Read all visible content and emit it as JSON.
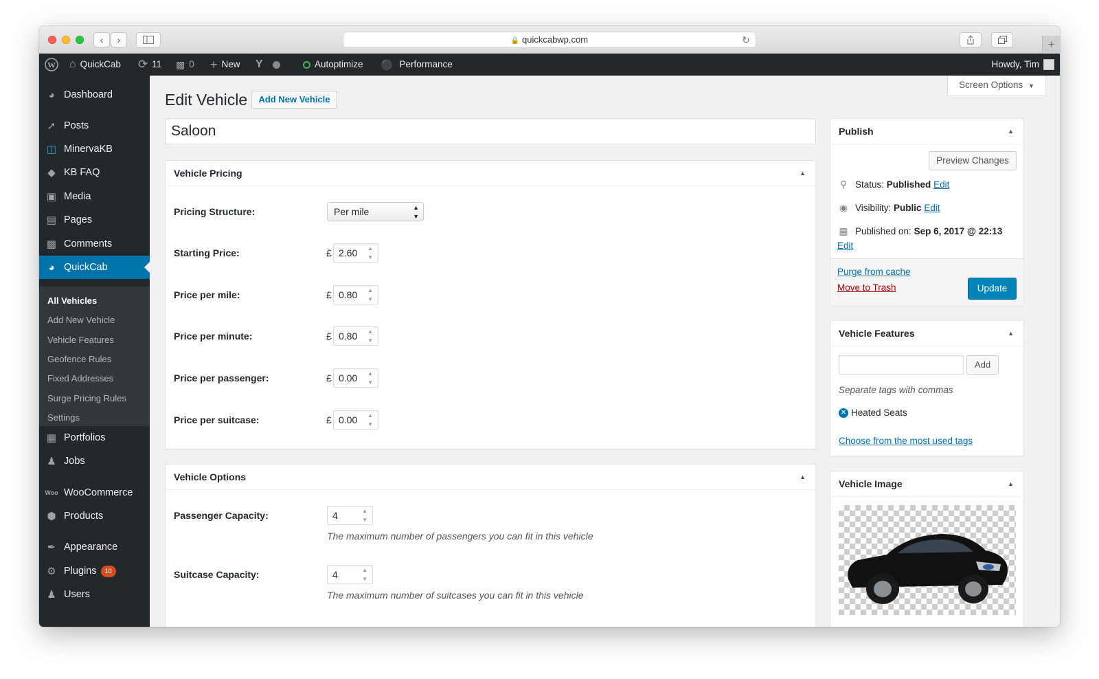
{
  "browser": {
    "url": "quickcabwp.com",
    "back_icon": "chevron-left",
    "forward_icon": "chevron-right",
    "new_tab_icon": "plus"
  },
  "admin_bar": {
    "site_name": "QuickCab",
    "updates_count": "11",
    "comments_count": "0",
    "new_label": "New",
    "autoptimize_label": "Autoptimize",
    "performance_label": "Performance",
    "greeting": "Howdy, Tim"
  },
  "sidebar": {
    "items": [
      {
        "label": "Dashboard",
        "icon": "gauge-icon"
      },
      {
        "label": "Posts",
        "icon": "pushpin-icon"
      },
      {
        "label": "MinervaKB",
        "icon": "library-icon"
      },
      {
        "label": "KB FAQ",
        "icon": "graduation-icon"
      },
      {
        "label": "Media",
        "icon": "media-icon"
      },
      {
        "label": "Pages",
        "icon": "pages-icon"
      },
      {
        "label": "Comments",
        "icon": "comment-icon"
      },
      {
        "label": "QuickCab",
        "icon": "gauge-icon"
      },
      {
        "label": "Portfolios",
        "icon": "folder-icon"
      },
      {
        "label": "Jobs",
        "icon": "person-icon"
      },
      {
        "label": "WooCommerce",
        "icon": "woo-icon"
      },
      {
        "label": "Products",
        "icon": "box-icon"
      },
      {
        "label": "Appearance",
        "icon": "brush-icon"
      },
      {
        "label": "Plugins",
        "icon": "plug-icon"
      },
      {
        "label": "Users",
        "icon": "user-icon"
      }
    ],
    "plugins_badge": "10",
    "submenu": [
      "All Vehicles",
      "Add New Vehicle",
      "Vehicle Features",
      "Geofence Rules",
      "Fixed Addresses",
      "Surge Pricing Rules",
      "Settings"
    ]
  },
  "header": {
    "title": "Edit Vehicle",
    "add_new_label": "Add New Vehicle",
    "screen_options_label": "Screen Options"
  },
  "post_title": "Saloon",
  "pricing": {
    "heading": "Vehicle Pricing",
    "structure_label": "Pricing Structure:",
    "structure_value": "Per mile",
    "currency": "£",
    "rows": [
      {
        "label": "Starting Price:",
        "value": "2.60"
      },
      {
        "label": "Price per mile:",
        "value": "0.80"
      },
      {
        "label": "Price per minute:",
        "value": "0.80"
      },
      {
        "label": "Price per passenger:",
        "value": "0.00"
      },
      {
        "label": "Price per suitcase:",
        "value": "0.00"
      }
    ]
  },
  "options": {
    "heading": "Vehicle Options",
    "passenger_label": "Passenger Capacity:",
    "passenger_value": "4",
    "passenger_desc": "The maximum number of passengers you can fit in this vehicle",
    "suitcase_label": "Suitcase Capacity:",
    "suitcase_value": "4",
    "suitcase_desc": "The maximum number of suitcases you can fit in this vehicle"
  },
  "publish": {
    "heading": "Publish",
    "preview_label": "Preview Changes",
    "status_label": "Status:",
    "status_value": "Published",
    "visibility_label": "Visibility:",
    "visibility_value": "Public",
    "published_label": "Published on:",
    "published_value": "Sep 6, 2017 @ 22:13",
    "edit_label": "Edit",
    "purge_label": "Purge from cache",
    "trash_label": "Move to Trash",
    "update_label": "Update"
  },
  "features": {
    "heading": "Vehicle Features",
    "add_label": "Add",
    "input_value": "",
    "hint": "Separate tags with commas",
    "tag": "Heated Seats",
    "choose_label": "Choose from the most used tags"
  },
  "image": {
    "heading": "Vehicle Image"
  },
  "colors": {
    "admin_dark": "#23282d",
    "submenu_bg": "#32373c",
    "accent": "#0073aa",
    "trash": "#a00",
    "badge": "#d54e21"
  }
}
